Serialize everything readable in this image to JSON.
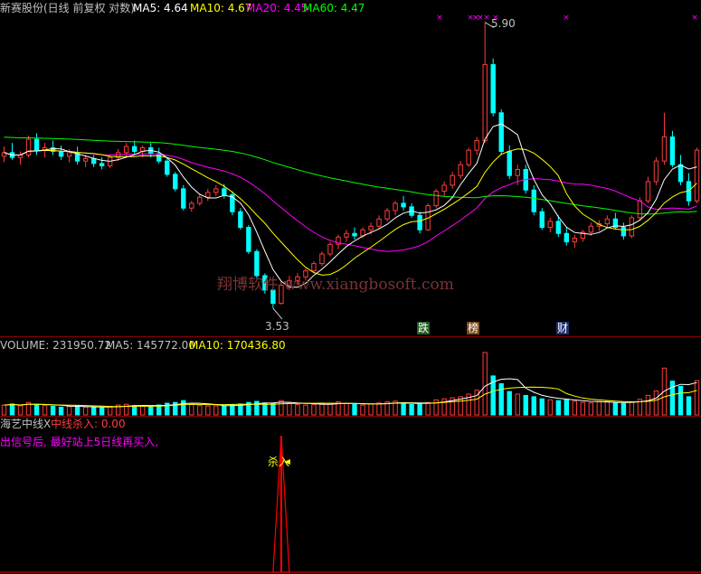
{
  "main_header": {
    "stock_name": "新赛股份(日线 前复权 对数)",
    "ma5_label": "MA5: 4.64",
    "ma10_label": "MA10: 4.67",
    "ma20_label": "MA20: 4.45",
    "ma60_label": "MA60: 4.47"
  },
  "volume_header": {
    "volume_label": "VOLUME: 231950.72",
    "ma5_label": "MA5: 145772.00",
    "ma10_label": "MA10: 170436.80"
  },
  "indicator_header": {
    "name": "海艺中线X",
    "signal_label": "中线杀入: 0.00",
    "note": "出信号后, 最好站上5日线再买入,"
  },
  "annotations": {
    "high_label": "5.90",
    "low_label": "3.53",
    "signal_arrow": "杀入"
  },
  "badges": [
    "跌",
    "榜",
    "财"
  ],
  "watermark": "翔博软件 www.xiangbosoft.com",
  "colors": {
    "up": "#ff3c3c",
    "down": "#00ffff",
    "ma5": "#ffffff",
    "ma10": "#ffff00",
    "ma20": "#ff00ff",
    "ma60": "#00ff00",
    "separator": "#8b0000",
    "signal": "#ff0000",
    "note": "#ff00ff"
  },
  "chart_data": {
    "type": "candlestick",
    "price_range": [
      3.53,
      5.9
    ],
    "annotated_high": 5.9,
    "annotated_low": 3.53,
    "last_ma": {
      "MA5": 4.64,
      "MA10": 4.67,
      "MA20": 4.45,
      "MA60": 4.47
    },
    "last_volume": {
      "VOLUME": 231950.72,
      "MA5": 145772.0,
      "MA10": 170436.8
    },
    "signal_value": 0.0,
    "candles": [
      [
        4.79,
        4.87,
        4.74,
        4.82
      ],
      [
        4.82,
        4.9,
        4.76,
        4.78
      ],
      [
        4.78,
        4.83,
        4.72,
        4.8
      ],
      [
        4.8,
        4.96,
        4.78,
        4.93
      ],
      [
        4.93,
        4.98,
        4.8,
        4.84
      ],
      [
        4.84,
        4.9,
        4.78,
        4.86
      ],
      [
        4.86,
        4.92,
        4.8,
        4.83
      ],
      [
        4.83,
        4.88,
        4.76,
        4.79
      ],
      [
        4.79,
        4.85,
        4.74,
        4.82
      ],
      [
        4.82,
        4.87,
        4.72,
        4.75
      ],
      [
        4.75,
        4.8,
        4.7,
        4.77
      ],
      [
        4.77,
        4.8,
        4.7,
        4.73
      ],
      [
        4.73,
        4.78,
        4.68,
        4.71
      ],
      [
        4.71,
        4.8,
        4.69,
        4.78
      ],
      [
        4.78,
        4.85,
        4.75,
        4.82
      ],
      [
        4.82,
        4.9,
        4.78,
        4.87
      ],
      [
        4.87,
        4.92,
        4.8,
        4.83
      ],
      [
        4.83,
        4.88,
        4.78,
        4.86
      ],
      [
        4.86,
        4.9,
        4.78,
        4.81
      ],
      [
        4.81,
        4.86,
        4.73,
        4.75
      ],
      [
        4.75,
        4.78,
        4.62,
        4.64
      ],
      [
        4.64,
        4.66,
        4.5,
        4.52
      ],
      [
        4.52,
        4.55,
        4.34,
        4.36
      ],
      [
        4.36,
        4.42,
        4.33,
        4.4
      ],
      [
        4.4,
        4.48,
        4.38,
        4.45
      ],
      [
        4.45,
        4.52,
        4.42,
        4.49
      ],
      [
        4.49,
        4.55,
        4.46,
        4.52
      ],
      [
        4.52,
        4.56,
        4.44,
        4.47
      ],
      [
        4.47,
        4.5,
        4.3,
        4.33
      ],
      [
        4.33,
        4.36,
        4.18,
        4.2
      ],
      [
        4.2,
        4.22,
        3.98,
        4.0
      ],
      [
        4.0,
        4.02,
        3.78,
        3.8
      ],
      [
        3.8,
        3.82,
        3.65,
        3.68
      ],
      [
        3.68,
        3.7,
        3.53,
        3.57
      ],
      [
        3.57,
        3.75,
        3.56,
        3.72
      ],
      [
        3.72,
        3.8,
        3.68,
        3.76
      ],
      [
        3.76,
        3.82,
        3.72,
        3.79
      ],
      [
        3.79,
        3.86,
        3.76,
        3.84
      ],
      [
        3.84,
        3.92,
        3.82,
        3.9
      ],
      [
        3.9,
        4.0,
        3.88,
        3.98
      ],
      [
        3.98,
        4.08,
        3.96,
        4.06
      ],
      [
        4.06,
        4.14,
        4.02,
        4.12
      ],
      [
        4.12,
        4.18,
        4.08,
        4.15
      ],
      [
        4.15,
        4.2,
        4.1,
        4.13
      ],
      [
        4.13,
        4.2,
        4.11,
        4.18
      ],
      [
        4.18,
        4.24,
        4.14,
        4.21
      ],
      [
        4.21,
        4.3,
        4.19,
        4.27
      ],
      [
        4.27,
        4.36,
        4.25,
        4.34
      ],
      [
        4.34,
        4.42,
        4.3,
        4.4
      ],
      [
        4.4,
        4.46,
        4.34,
        4.37
      ],
      [
        4.37,
        4.4,
        4.28,
        4.3
      ],
      [
        4.3,
        4.33,
        4.15,
        4.18
      ],
      [
        4.18,
        4.4,
        4.17,
        4.38
      ],
      [
        4.38,
        4.52,
        4.36,
        4.5
      ],
      [
        4.5,
        4.58,
        4.46,
        4.55
      ],
      [
        4.55,
        4.66,
        4.52,
        4.63
      ],
      [
        4.63,
        4.75,
        4.6,
        4.72
      ],
      [
        4.72,
        4.86,
        4.7,
        4.84
      ],
      [
        4.84,
        4.95,
        4.8,
        4.92
      ],
      [
        4.92,
        5.9,
        4.9,
        5.55
      ],
      [
        5.55,
        5.6,
        5.12,
        5.15
      ],
      [
        5.15,
        5.18,
        4.8,
        4.83
      ],
      [
        4.83,
        4.88,
        4.6,
        4.63
      ],
      [
        4.63,
        4.72,
        4.55,
        4.68
      ],
      [
        4.68,
        4.72,
        4.48,
        4.51
      ],
      [
        4.51,
        4.55,
        4.3,
        4.33
      ],
      [
        4.33,
        4.36,
        4.18,
        4.2
      ],
      [
        4.2,
        4.28,
        4.16,
        4.25
      ],
      [
        4.25,
        4.3,
        4.12,
        4.15
      ],
      [
        4.15,
        4.2,
        4.05,
        4.08
      ],
      [
        4.08,
        4.14,
        4.03,
        4.11
      ],
      [
        4.11,
        4.18,
        4.08,
        4.16
      ],
      [
        4.16,
        4.24,
        4.13,
        4.21
      ],
      [
        4.21,
        4.26,
        4.17,
        4.23
      ],
      [
        4.23,
        4.3,
        4.2,
        4.27
      ],
      [
        4.27,
        4.32,
        4.18,
        4.2
      ],
      [
        4.2,
        4.24,
        4.1,
        4.13
      ],
      [
        4.13,
        4.3,
        4.11,
        4.28
      ],
      [
        4.28,
        4.45,
        4.26,
        4.42
      ],
      [
        4.42,
        4.62,
        4.4,
        4.58
      ],
      [
        4.58,
        4.78,
        4.55,
        4.75
      ],
      [
        4.75,
        5.15,
        4.72,
        4.95
      ],
      [
        4.95,
        5.0,
        4.7,
        4.72
      ],
      [
        4.72,
        4.8,
        4.55,
        4.58
      ],
      [
        4.58,
        4.65,
        4.38,
        4.42
      ],
      [
        4.42,
        4.86,
        4.4,
        4.84
      ]
    ],
    "volumes": [
      38,
      42,
      35,
      48,
      40,
      36,
      33,
      30,
      32,
      35,
      30,
      28,
      27,
      33,
      38,
      41,
      36,
      34,
      32,
      38,
      45,
      48,
      55,
      40,
      36,
      34,
      35,
      33,
      40,
      42,
      48,
      52,
      46,
      44,
      55,
      45,
      40,
      38,
      40,
      43,
      45,
      50,
      44,
      40,
      38,
      42,
      46,
      50,
      53,
      44,
      40,
      42,
      48,
      58,
      62,
      66,
      70,
      80,
      95,
      240,
      150,
      120,
      90,
      80,
      75,
      70,
      62,
      58,
      55,
      60,
      52,
      48,
      46,
      50,
      52,
      46,
      44,
      50,
      60,
      75,
      92,
      180,
      130,
      110,
      70,
      132
    ],
    "signal_index": 34,
    "signal_peak": 1.0
  }
}
